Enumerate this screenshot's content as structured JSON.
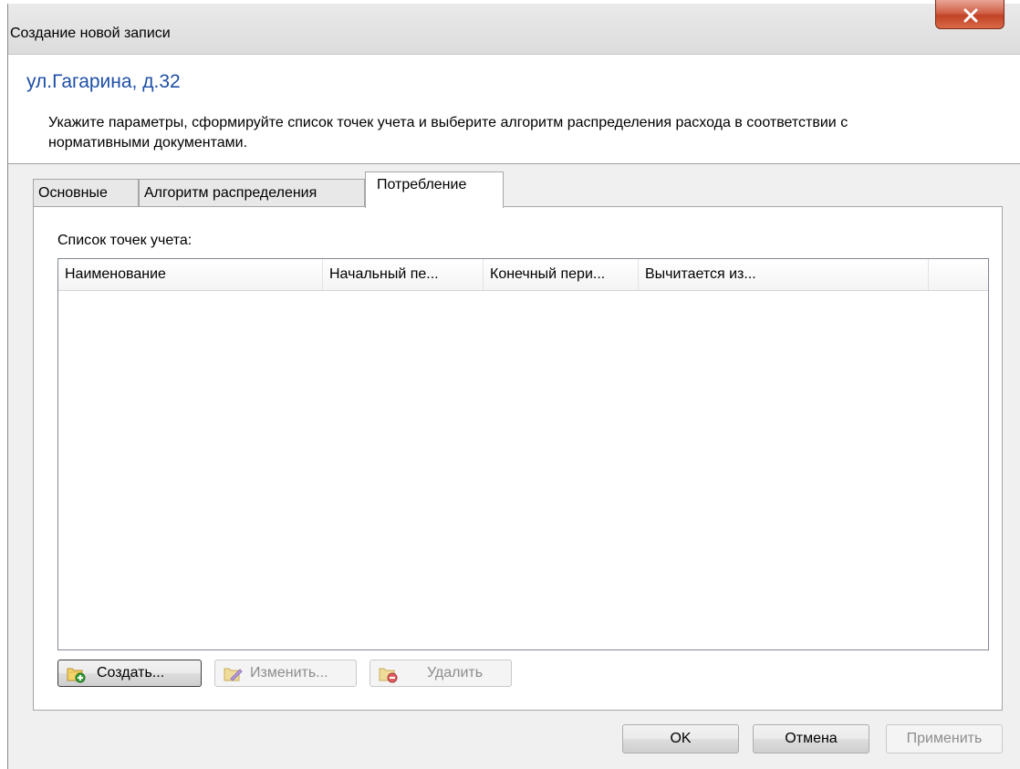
{
  "window": {
    "title": "Создание новой записи",
    "close_label": "x"
  },
  "header": {
    "address": "ул.Гагарина, д.32",
    "instruction": "Укажите параметры, сформируйте список точек учета и выберите алгоритм распределения расхода в соответствии с нормативными документами."
  },
  "tabs": [
    {
      "label": "Основные",
      "active": false
    },
    {
      "label": "Алгоритм распределения",
      "active": false
    },
    {
      "label": "Потребление",
      "active": true
    }
  ],
  "panel": {
    "list_label": "Список точек учета:",
    "columns": [
      "Наименование",
      "Начальный пе...",
      "Конечный пери...",
      "Вычитается из..."
    ],
    "rows": [],
    "buttons": {
      "create": "Создать...",
      "edit": "Изменить...",
      "delete": "Удалить"
    }
  },
  "footer": {
    "ok": "OK",
    "cancel": "Отмена",
    "apply": "Применить"
  },
  "colors": {
    "accent_title": "#1f4fa6",
    "close_button": "#c24226"
  }
}
